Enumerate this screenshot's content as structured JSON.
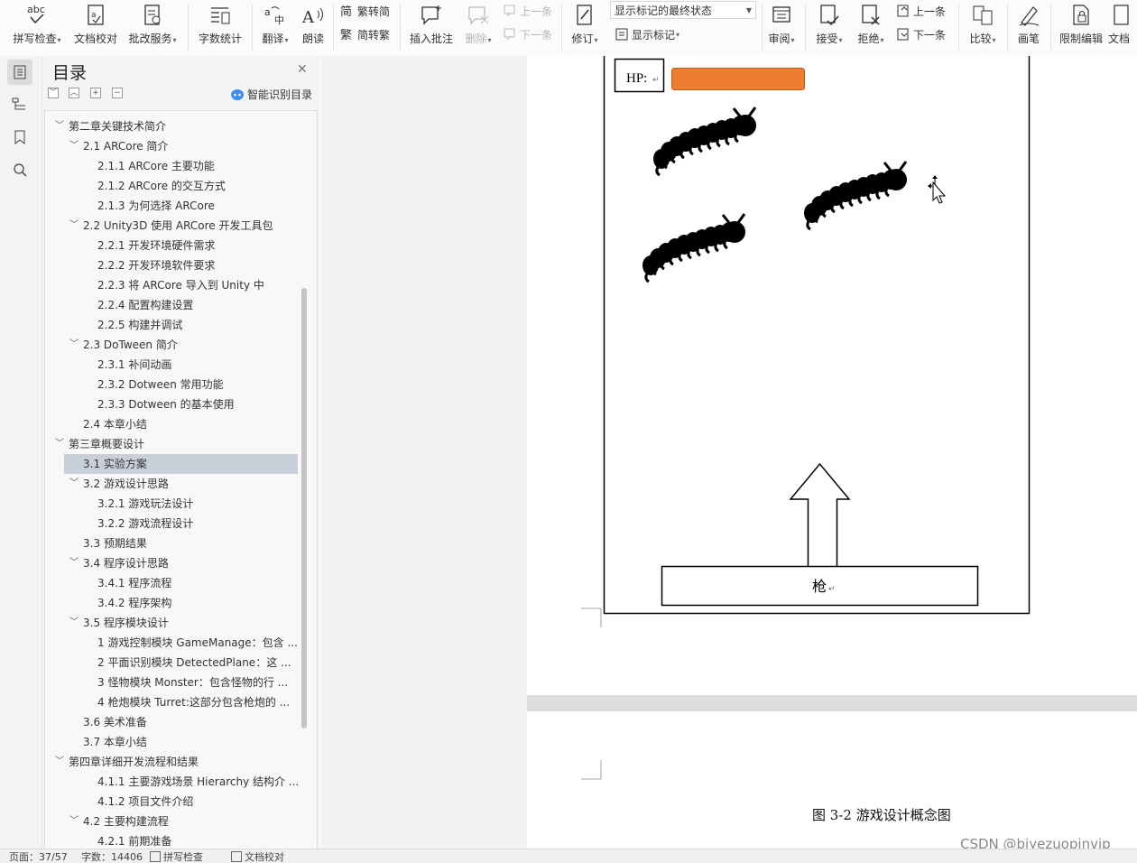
{
  "ribbon": {
    "spell_check": "拼写检查",
    "doc_check": "文档校对",
    "review_service": "批改服务",
    "word_count": "字数统计",
    "translate": "翻译",
    "read_aloud": "朗读",
    "to_traditional": "繁转简",
    "to_simplified": "简转繁",
    "insert_comment": "插入批注",
    "delete": "删除",
    "prev_comment": "上一条",
    "next_comment": "下一条",
    "revise": "修订",
    "markup_state": "显示标记的最终状态",
    "show_markup": "显示标记",
    "review": "审阅",
    "accept": "接受",
    "reject": "拒绝",
    "prev_change": "上一条",
    "next_change": "下一条",
    "compare": "比较",
    "pen": "画笔",
    "restrict_edit": "限制编辑",
    "doc_cut": "文档"
  },
  "toc": {
    "title": "目录",
    "smart": "智能识别目录",
    "items": [
      {
        "level": 1,
        "text": "第二章关键技术简介",
        "chev": "﹀"
      },
      {
        "level": 2,
        "text": "2.1 ARCore 简介",
        "chev": "﹀"
      },
      {
        "level": 3,
        "text": "2.1.1 ARCore 主要功能",
        "chev": ""
      },
      {
        "level": 3,
        "text": "2.1.2 ARCore 的交互方式",
        "chev": ""
      },
      {
        "level": 3,
        "text": "2.1.3 为何选择 ARCore",
        "chev": ""
      },
      {
        "level": 2,
        "text": "2.2 Unity3D 使用 ARCore 开发工具包",
        "chev": "﹀"
      },
      {
        "level": 3,
        "text": "2.2.1 开发环境硬件需求",
        "chev": ""
      },
      {
        "level": 3,
        "text": "2.2.2 开发环境软件要求",
        "chev": ""
      },
      {
        "level": 3,
        "text": "2.2.3 将 ARCore 导入到 Unity 中",
        "chev": ""
      },
      {
        "level": 3,
        "text": "2.2.4 配置构建设置",
        "chev": ""
      },
      {
        "level": 3,
        "text": "2.2.5 构建并调试",
        "chev": ""
      },
      {
        "level": 2,
        "text": "2.3 DoTween 简介",
        "chev": "﹀"
      },
      {
        "level": 3,
        "text": "2.3.1 补间动画",
        "chev": ""
      },
      {
        "level": 3,
        "text": "2.3.2 Dotween 常用功能",
        "chev": ""
      },
      {
        "level": 3,
        "text": "2.3.3 Dotween 的基本使用",
        "chev": ""
      },
      {
        "level": 2,
        "text": "2.4 本章小结",
        "chev": ""
      },
      {
        "level": 1,
        "text": "第三章概要设计",
        "chev": "﹀"
      },
      {
        "level": 2,
        "text": "3.1 实验方案",
        "chev": "",
        "selected": true
      },
      {
        "level": 2,
        "text": "3.2 游戏设计思路",
        "chev": "﹀"
      },
      {
        "level": 3,
        "text": "3.2.1 游戏玩法设计",
        "chev": ""
      },
      {
        "level": 3,
        "text": "3.2.2 游戏流程设计",
        "chev": ""
      },
      {
        "level": 2,
        "text": "3.3 预期结果",
        "chev": ""
      },
      {
        "level": 2,
        "text": "3.4 程序设计思路",
        "chev": "﹀"
      },
      {
        "level": 3,
        "text": "3.4.1 程序流程",
        "chev": ""
      },
      {
        "level": 3,
        "text": "3.4.2 程序架构",
        "chev": ""
      },
      {
        "level": 2,
        "text": "3.5 程序模块设计",
        "chev": "﹀"
      },
      {
        "level": 3,
        "text": "1 游戏控制模块 GameManage：包含 ...",
        "chev": ""
      },
      {
        "level": 3,
        "text": "2 平面识别模块 DetectedPlane：这 ...",
        "chev": ""
      },
      {
        "level": 3,
        "text": "3 怪物模块 Monster：包含怪物的行 ...",
        "chev": ""
      },
      {
        "level": 3,
        "text": "4 枪炮模块 Turret:这部分包含枪炮的 ...",
        "chev": ""
      },
      {
        "level": 2,
        "text": "3.6 美术准备",
        "chev": ""
      },
      {
        "level": 2,
        "text": "3.7 本章小结",
        "chev": ""
      },
      {
        "level": 1,
        "text": "第四章详细开发流程和结果",
        "chev": "﹀"
      },
      {
        "level": 3,
        "text": "4.1.1 主要游戏场景 Hierarchy 结构介 ...",
        "chev": ""
      },
      {
        "level": 3,
        "text": "4.1.2 项目文件介绍",
        "chev": ""
      },
      {
        "level": 2,
        "text": "4.2 主要构建流程",
        "chev": "﹀"
      },
      {
        "level": 3,
        "text": "4.2.1 前期准备",
        "chev": ""
      }
    ]
  },
  "doc": {
    "hp_label": "HP:",
    "gun_label": "枪",
    "caption": "图 3-2 游戏设计概念图",
    "watermark": "CSDN @biyezuopinvip",
    "hp_color": "#ED7D31"
  },
  "status": {
    "page": "页面：37/57",
    "words": "字数：14406",
    "spell": "拼写检查",
    "check": "文档校对"
  }
}
